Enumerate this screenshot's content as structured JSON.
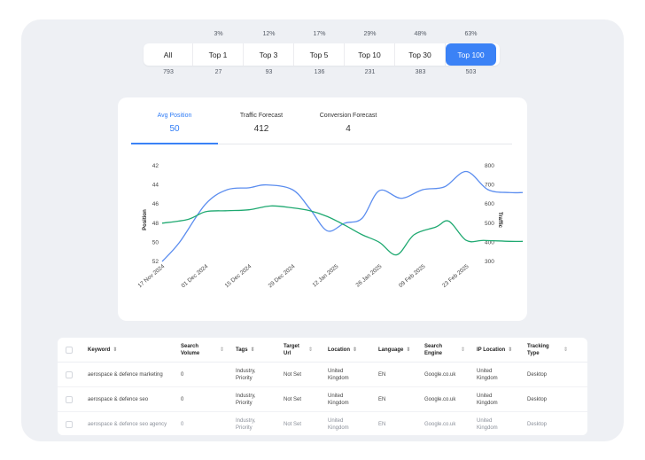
{
  "filters": {
    "percents": [
      "",
      "3%",
      "12%",
      "17%",
      "29%",
      "48%",
      "63%"
    ],
    "buttons": [
      "All",
      "Top 1",
      "Top 3",
      "Top 5",
      "Top 10",
      "Top 30",
      "Top 100"
    ],
    "counts": [
      "793",
      "27",
      "93",
      "136",
      "231",
      "383",
      "503"
    ],
    "active": "Top 100",
    "accent": "#3b82f6"
  },
  "tabs": [
    {
      "label": "Avg Position",
      "value": "50"
    },
    {
      "label": "Traffic Forecast",
      "value": "412"
    },
    {
      "label": "Conversion Forecast",
      "value": "4"
    }
  ],
  "chart_data": {
    "type": "line",
    "x": [
      "17 Nov 2024",
      "01 Dec 2024",
      "15 Dec 2024",
      "29 Dec 2024",
      "12 Jan 2025",
      "26 Jan 2025",
      "09 Feb 2025",
      "23 Feb 2025"
    ],
    "ylabel": "Position",
    "y2label": "Traffic",
    "ylim": [
      52,
      42
    ],
    "y2lim": [
      300,
      800
    ],
    "yticks": [
      "42",
      "44",
      "46",
      "48",
      "50",
      "52"
    ],
    "y2ticks": [
      "800",
      "700",
      "600",
      "500",
      "400",
      "300"
    ],
    "series": [
      {
        "axis": "left",
        "color": "#5b8def",
        "points": [
          [
            0,
            52
          ],
          [
            0.4,
            50
          ],
          [
            1,
            46
          ],
          [
            1.5,
            44.5
          ],
          [
            2,
            44.3
          ],
          [
            2.4,
            44
          ],
          [
            3,
            44.5
          ],
          [
            3.4,
            46.5
          ],
          [
            3.8,
            48.8
          ],
          [
            4.2,
            48
          ],
          [
            4.6,
            47.5
          ],
          [
            5,
            44.6
          ],
          [
            5.5,
            45.4
          ],
          [
            6,
            44.5
          ],
          [
            6.5,
            44.2
          ],
          [
            7,
            42.6
          ],
          [
            7.5,
            44.5
          ],
          [
            8,
            44.8
          ],
          [
            8.3,
            44.8
          ]
        ]
      },
      {
        "axis": "right",
        "color": "#1fa971",
        "points": [
          [
            0,
            500
          ],
          [
            0.6,
            520
          ],
          [
            1,
            560
          ],
          [
            1.5,
            565
          ],
          [
            2,
            570
          ],
          [
            2.5,
            590
          ],
          [
            3,
            580
          ],
          [
            3.4,
            565
          ],
          [
            3.8,
            535
          ],
          [
            4.2,
            490
          ],
          [
            4.6,
            440
          ],
          [
            5,
            400
          ],
          [
            5.4,
            335
          ],
          [
            5.8,
            440
          ],
          [
            6.3,
            480
          ],
          [
            6.6,
            510
          ],
          [
            7,
            410
          ],
          [
            7.4,
            410
          ],
          [
            8,
            405
          ],
          [
            8.3,
            405
          ]
        ]
      }
    ],
    "grid": false
  },
  "table": {
    "headers": [
      "Keyword",
      "Search Volume",
      "Tags",
      "Target Url",
      "Location",
      "Language",
      "Search Engine",
      "IP Location",
      "Tracking Type"
    ],
    "rows": [
      [
        "aerospace & defence marketing",
        "0",
        "Industry, Priority",
        "Not Set",
        "United Kingdom",
        "EN",
        "Google.co.uk",
        "United Kingdom",
        "Desktop"
      ],
      [
        "aerospace & defence seo",
        "0",
        "Industry, Priority",
        "Not Set",
        "United Kingdom",
        "EN",
        "Google.co.uk",
        "United Kingdom",
        "Desktop"
      ],
      [
        "aerospace & defence seo agency",
        "0",
        "Industry, Priority",
        "Not Set",
        "United Kingdom",
        "EN",
        "Google.co.uk",
        "United Kingdom",
        "Desktop"
      ]
    ]
  }
}
